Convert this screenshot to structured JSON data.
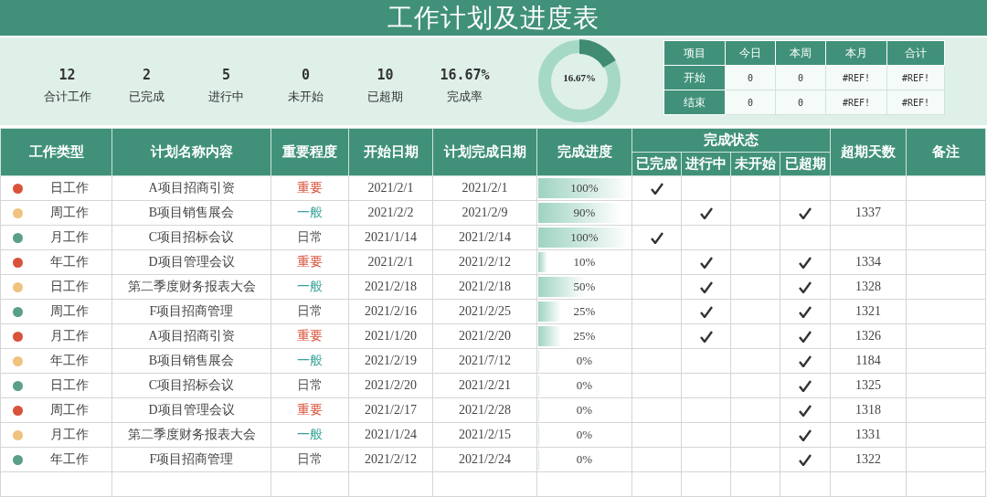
{
  "title": "工作计划及进度表",
  "stats": [
    {
      "value": "12",
      "label": "合计工作"
    },
    {
      "value": "2",
      "label": "已完成"
    },
    {
      "value": "5",
      "label": "进行中"
    },
    {
      "value": "0",
      "label": "未开始"
    },
    {
      "value": "10",
      "label": "已超期"
    },
    {
      "value": "16.67%",
      "label": "完成率"
    }
  ],
  "ring": {
    "level": 0.1667,
    "label": "16.67%"
  },
  "mini_table": {
    "columns": [
      "项目",
      "今日",
      "本周",
      "本月",
      "合计"
    ],
    "rows": [
      [
        "开始",
        "0",
        "0",
        "#REF!",
        "#REF!"
      ],
      [
        "结束",
        "0",
        "0",
        "#REF!",
        "#REF!"
      ]
    ]
  },
  "table": {
    "columns": [
      "工作类型",
      "计划名称内容",
      "重要程度",
      "开始日期",
      "计划完成日期",
      "完成进度",
      "完成状态",
      "超期天数",
      "备注"
    ],
    "status_columns": [
      "已完成",
      "进行中",
      "未开始",
      "已超期"
    ],
    "rows": [
      {
        "type": "日工作",
        "color": "#d9533a",
        "name": "A项目招商引资",
        "priority": {
          "text": "重要",
          "color": "#d9533a"
        },
        "start": "2021/2/1",
        "end": "2021/2/1",
        "level": 1,
        "progress": "100%",
        "status": [
          true,
          false,
          false,
          false
        ]
      },
      {
        "type": "周工作",
        "color": "#f0c27f",
        "name": "B项目销售展会",
        "priority": {
          "text": "一般",
          "color": "#3aa39a"
        },
        "start": "2021/2/2",
        "end": "2021/2/9",
        "level": 0.9,
        "progress": "90%",
        "status": [
          false,
          true,
          false,
          true
        ],
        "overdue_days": "1337"
      },
      {
        "type": "月工作",
        "color": "#5a9f88",
        "name": "C项目招标会议",
        "priority": {
          "text": "日常",
          "color": "#555555"
        },
        "start": "2021/1/14",
        "end": "2021/2/14",
        "level": 1,
        "progress": "100%",
        "status": [
          true,
          false,
          false,
          false
        ]
      },
      {
        "type": "年工作",
        "color": "#d9533a",
        "name": "D项目管理会议",
        "priority": {
          "text": "重要",
          "color": "#d9533a"
        },
        "start": "2021/2/1",
        "end": "2021/2/12",
        "level": 0.1,
        "progress": "10%",
        "status": [
          false,
          true,
          false,
          true
        ],
        "overdue_days": "1334"
      },
      {
        "type": "日工作",
        "color": "#f0c27f",
        "name": "第二季度财务报表大会",
        "priority": {
          "text": "一般",
          "color": "#3aa39a"
        },
        "start": "2021/2/18",
        "end": "2021/2/18",
        "level": 0.5,
        "progress": "50%",
        "status": [
          false,
          true,
          false,
          true
        ],
        "overdue_days": "1328"
      },
      {
        "type": "周工作",
        "color": "#5a9f88",
        "name": "F项目招商管理",
        "priority": {
          "text": "日常",
          "color": "#555555"
        },
        "start": "2021/2/16",
        "end": "2021/2/25",
        "level": 0.25,
        "progress": "25%",
        "status": [
          false,
          true,
          false,
          true
        ],
        "overdue_days": "1321"
      },
      {
        "type": "月工作",
        "color": "#d9533a",
        "name": "A项目招商引资",
        "priority": {
          "text": "重要",
          "color": "#d9533a"
        },
        "start": "2021/1/20",
        "end": "2021/2/20",
        "level": 0.25,
        "progress": "25%",
        "status": [
          false,
          true,
          false,
          true
        ],
        "overdue_days": "1326"
      },
      {
        "type": "年工作",
        "color": "#f0c27f",
        "name": "B项目销售展会",
        "priority": {
          "text": "一般",
          "color": "#3aa39a"
        },
        "start": "2021/2/19",
        "end": "2021/7/12",
        "level": 0,
        "progress": "0%",
        "status": [
          false,
          false,
          false,
          true
        ],
        "overdue_days": "1184"
      },
      {
        "type": "日工作",
        "color": "#5a9f88",
        "name": "C项目招标会议",
        "priority": {
          "text": "日常",
          "color": "#555555"
        },
        "start": "2021/2/20",
        "end": "2021/2/21",
        "level": 0,
        "progress": "0%",
        "status": [
          false,
          false,
          false,
          true
        ],
        "overdue_days": "1325"
      },
      {
        "type": "周工作",
        "color": "#d9533a",
        "name": "D项目管理会议",
        "priority": {
          "text": "重要",
          "color": "#d9533a"
        },
        "start": "2021/2/17",
        "end": "2021/2/28",
        "level": 0,
        "progress": "0%",
        "status": [
          false,
          false,
          false,
          true
        ],
        "overdue_days": "1318"
      },
      {
        "type": "月工作",
        "color": "#f0c27f",
        "name": "第二季度财务报表大会",
        "priority": {
          "text": "一般",
          "color": "#3aa39a"
        },
        "start": "2021/1/24",
        "end": "2021/2/15",
        "level": 0,
        "progress": "0%",
        "status": [
          false,
          false,
          false,
          true
        ],
        "overdue_days": "1331"
      },
      {
        "type": "年工作",
        "color": "#5a9f88",
        "name": "F项目招商管理",
        "priority": {
          "text": "日常",
          "color": "#555555"
        },
        "start": "2021/2/12",
        "end": "2021/2/24",
        "level": 0,
        "progress": "0%",
        "status": [
          false,
          false,
          false,
          true
        ],
        "overdue_days": "1322"
      }
    ]
  }
}
